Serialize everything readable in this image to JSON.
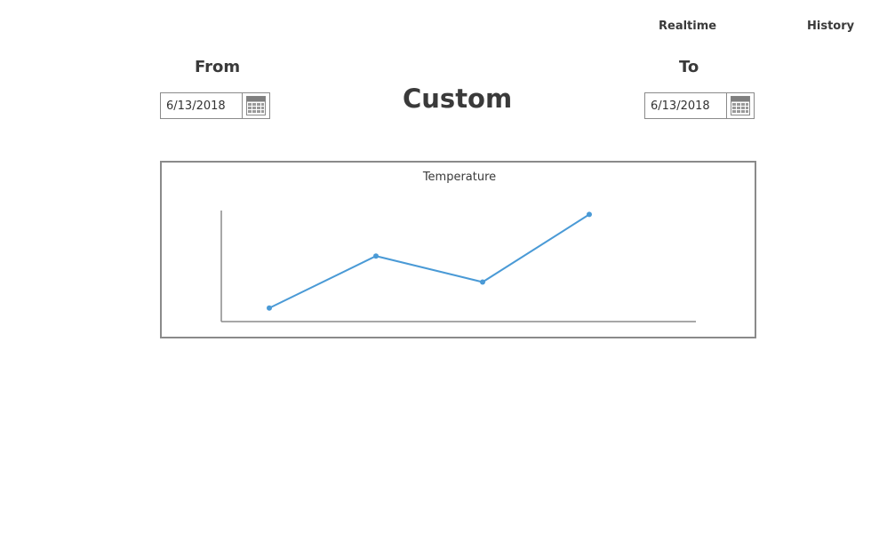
{
  "nav": {
    "realtime_label": "Realtime",
    "history_label": "History"
  },
  "page_title": "Custom",
  "from": {
    "label": "From",
    "value": "6/13/2018"
  },
  "to": {
    "label": "To",
    "value": "6/13/2018"
  },
  "icons": {
    "date_picker_button": "calendar-icon"
  },
  "colors": {
    "series_line": "#4a9ad6",
    "panel_border": "#8a8a8a",
    "axis": "#8a8a8a",
    "text": "#3a3a3a"
  },
  "chart_data": {
    "type": "line",
    "title": "Temperature",
    "x": [
      1,
      2,
      3,
      4
    ],
    "series": [
      {
        "values": [
          1,
          6,
          3.5,
          10
        ]
      }
    ],
    "xlim": [
      0.55,
      5
    ],
    "ylim": [
      -0.3,
      11.4
    ],
    "grid": false,
    "xlabel": "",
    "ylabel": "",
    "tick_labels": false,
    "markers": true
  }
}
